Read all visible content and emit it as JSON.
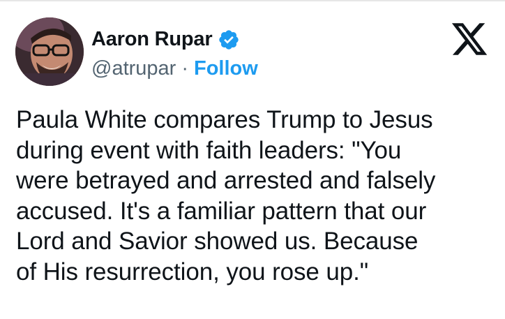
{
  "author": {
    "name": "Aaron Rupar",
    "handle": "@atrupar",
    "separator": "·",
    "follow_label": "Follow",
    "avatar_icon": "profile-photo",
    "verified_icon": "verified-badge-icon"
  },
  "platform": {
    "logo_icon": "x-logo-icon"
  },
  "tweet": {
    "text": "Paula White compares Trump to Jesus\nduring event with faith leaders: \"You\nwere betrayed and arrested and falsely\naccused. It's a familiar pattern that our\nLord and Savior showed us. Because\nof His resurrection, you rose up.\""
  },
  "colors": {
    "accent": "#1d9bf0",
    "secondary_text": "#536471",
    "primary_text": "#0f1419"
  }
}
